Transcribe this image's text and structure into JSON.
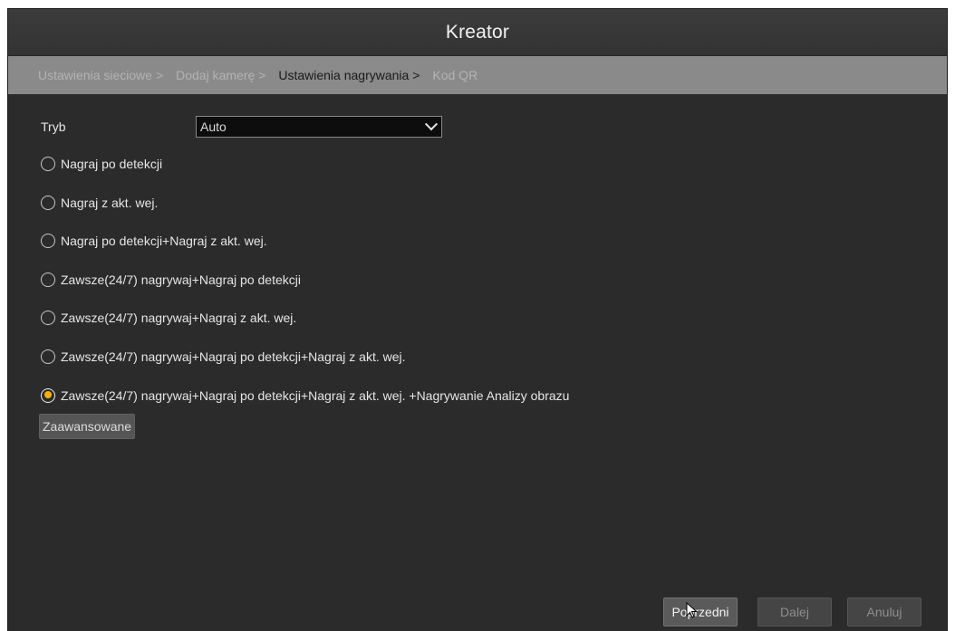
{
  "window": {
    "title": "Kreator"
  },
  "steps": [
    {
      "label": "Ustawienia sieciowe >",
      "active": false
    },
    {
      "label": "Dodaj kamerę >",
      "active": false
    },
    {
      "label": "Ustawienia nagrywania >",
      "active": true
    },
    {
      "label": "Kod QR",
      "active": false
    }
  ],
  "mode": {
    "label": "Tryb",
    "value": "Auto"
  },
  "options": [
    {
      "label": "Nagraj po detekcji",
      "checked": false
    },
    {
      "label": "Nagraj z akt. wej.",
      "checked": false
    },
    {
      "label": "Nagraj po detekcji+Nagraj z akt. wej.",
      "checked": false
    },
    {
      "label": "Zawsze(24/7) nagrywaj+Nagraj po detekcji",
      "checked": false
    },
    {
      "label": "Zawsze(24/7) nagrywaj+Nagraj z akt. wej.",
      "checked": false
    },
    {
      "label": "Zawsze(24/7) nagrywaj+Nagraj po detekcji+Nagraj z akt. wej.",
      "checked": false
    },
    {
      "label": "Zawsze(24/7) nagrywaj+Nagraj po detekcji+Nagraj z akt. wej. +Nagrywanie Analizy obrazu",
      "checked": true
    }
  ],
  "advanced_label": "Zaawansowane",
  "footer": {
    "prev_label": "Poprzedni",
    "next_label": "Dalej",
    "cancel_label": "Anuluj"
  },
  "colors": {
    "accent": "#f5b400",
    "steps_bar": "#8a8a8a",
    "background": "#2b2b2b"
  }
}
